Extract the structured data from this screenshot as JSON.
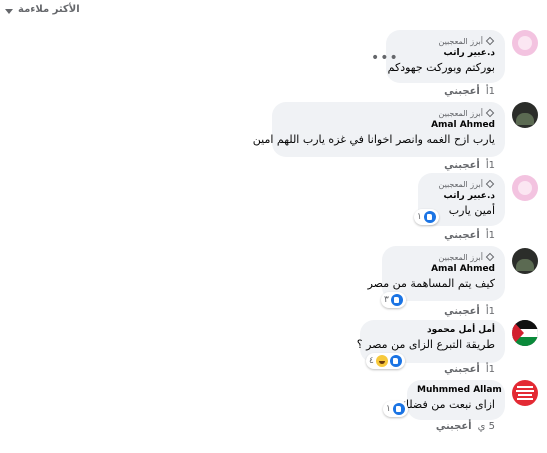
{
  "sort": {
    "label": "الأكثر ملاءمة"
  },
  "badge_label": "أبرز المعجبين",
  "more_options": "•••",
  "comments": [
    {
      "author": "د.عبير راتب",
      "text": "بوركتم وبوركت جهودكم",
      "time": "1أ",
      "like": "أعجبني",
      "reaction_count": "",
      "avatar": "pink"
    },
    {
      "author": "Amal Ahmed",
      "text": "يارب ازح الغمه وانصر اخوانا في غزه يارب اللهم امين",
      "time": "1أ",
      "like": "أعجبني",
      "reaction_count": "",
      "avatar": "dark"
    },
    {
      "author": "د.عبير راتب",
      "text": "أمين يارب",
      "time": "1أ",
      "like": "أعجبني",
      "reaction_count": "١",
      "avatar": "pink"
    },
    {
      "author": "Amal Ahmed",
      "text": "كيف يتم المساهمة من مصر",
      "time": "1أ",
      "like": "أعجبني",
      "reaction_count": "٣",
      "avatar": "dark"
    },
    {
      "author": "أمل أمل محمود",
      "text": "طريقة التبرع الزاى من مصر ؟",
      "time": "1أ",
      "like": "أعجبني",
      "reaction_count": "٤",
      "avatar": "flag"
    },
    {
      "author": "Muhmmed Allam",
      "text": "ازاى نبعت من فضلك",
      "time": "5 ي",
      "like": "أعجبني",
      "reaction_count": "١",
      "avatar": "red"
    }
  ],
  "colors": {
    "bubble": "#f0f2f5",
    "meta": "#65676b",
    "like": "#1b74e4"
  }
}
